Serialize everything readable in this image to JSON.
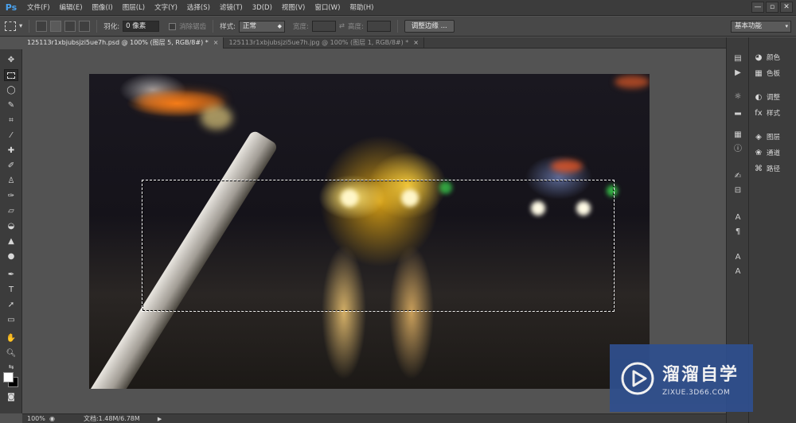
{
  "app": {
    "logo": "Ps",
    "menu": [
      "文件(F)",
      "编辑(E)",
      "图像(I)",
      "图层(L)",
      "文字(Y)",
      "选择(S)",
      "滤镜(T)",
      "3D(D)",
      "视图(V)",
      "窗口(W)",
      "帮助(H)"
    ],
    "window_controls": [
      "—",
      "▫",
      "✕"
    ]
  },
  "options": {
    "feather_label": "羽化:",
    "feather_value": "0 像素",
    "antialias_label": "消除锯齿",
    "style_label": "样式:",
    "style_value": "正常",
    "width_label": "宽度:",
    "height_label": "高度:",
    "refine_edge_button": "调整边缘 ...",
    "workspace_value": "基本功能"
  },
  "tabs": [
    {
      "title": "125113r1xbjubsjzi5ue7h.psd @ 100% (图层 5, RGB/8#) *",
      "close": "×",
      "active": true
    },
    {
      "title": "125113r1xbjubsjzi5ue7h.jpg @ 100% (图层 1, RGB/8#) *",
      "close": "×",
      "active": false
    }
  ],
  "panels": [
    {
      "icon": "palette-icon",
      "label": "颜色"
    },
    {
      "icon": "swatches-icon",
      "label": "色板"
    },
    {
      "icon": "adjustments-icon",
      "label": "调整"
    },
    {
      "icon": "styles-icon",
      "label": "样式"
    },
    {
      "icon": "layers-icon",
      "label": "图层"
    },
    {
      "icon": "channels-icon",
      "label": "通道"
    },
    {
      "icon": "paths-icon",
      "label": "路径"
    }
  ],
  "status": {
    "zoom": "100%",
    "doc_info": "文档:1.48M/6.78M",
    "arrow": "▶"
  },
  "watermark": {
    "title": "溜溜自学",
    "url": "ZIXUE.3D66.COM"
  },
  "colors": {
    "accent": "#4aa3f0",
    "foreground": "#ffffff",
    "background": "#000000",
    "watermark_bg": "#2f4f8e"
  }
}
